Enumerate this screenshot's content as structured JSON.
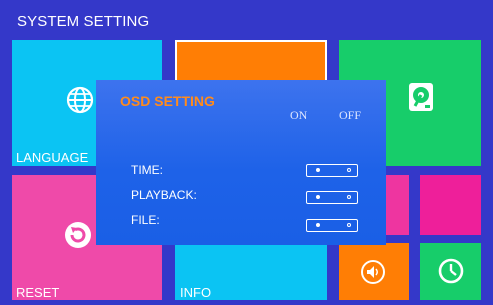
{
  "header": {
    "title": "SYSTEM SETTING"
  },
  "tiles": {
    "language": {
      "label": "LANGUAGE",
      "icon": "globe-icon"
    },
    "storage": {
      "icon": "hdd-icon"
    },
    "reset": {
      "label": "RESET",
      "icon": "reset-icon"
    },
    "info": {
      "label": "INFO"
    },
    "volume": {
      "icon": "speaker-icon"
    },
    "clock": {
      "icon": "clock-icon"
    }
  },
  "dialog": {
    "title": "OSD SETTING",
    "col_on": "ON",
    "col_off": "OFF",
    "rows": [
      {
        "label": "TIME:",
        "state": "ON"
      },
      {
        "label": "PLAYBACK:",
        "state": "ON"
      },
      {
        "label": "FILE:",
        "state": "ON"
      }
    ]
  },
  "colors": {
    "background": "#3438c9",
    "cyan": "#0bc4f3",
    "orange": "#ff7e05",
    "green": "#17cd6a",
    "pink": "#ef4aa9",
    "dialog_title": "#ff8b1c",
    "dialog_bg": "#1e62e8"
  }
}
